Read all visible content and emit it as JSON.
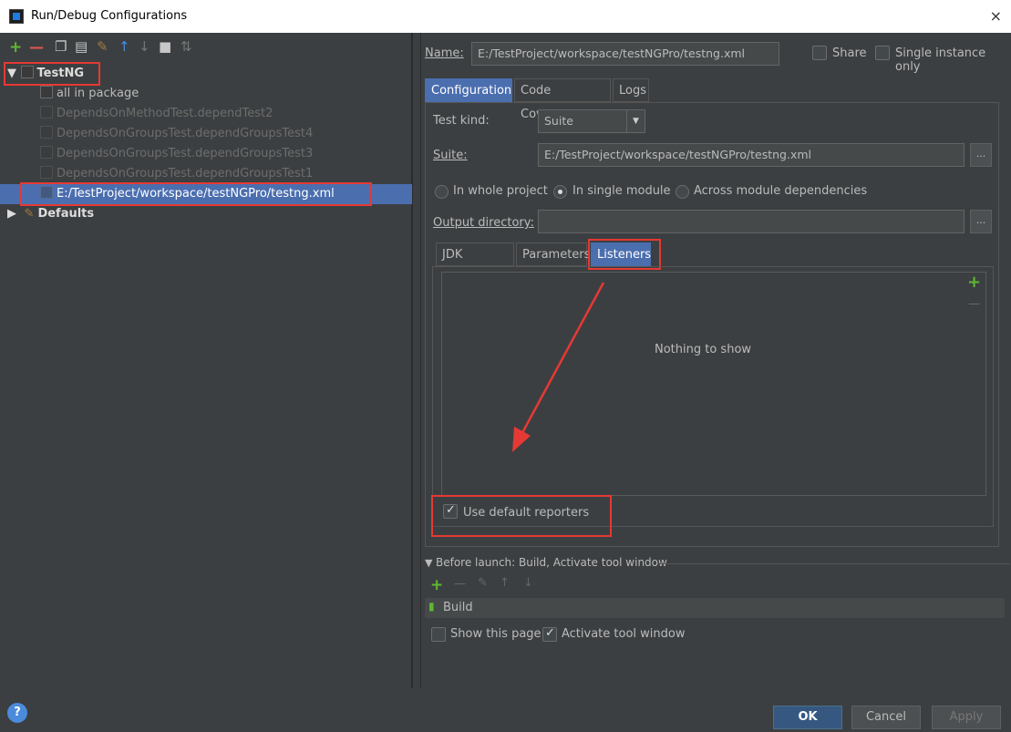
{
  "window": {
    "title": "Run/Debug Configurations",
    "close": "×"
  },
  "toolbar": {
    "add": "+",
    "remove": "—"
  },
  "tree": {
    "testng_label": "TestNG",
    "items": [
      "all in package",
      "DependsOnMethodTest.dependTest2",
      "DependsOnGroupsTest.dependGroupsTest4",
      "DependsOnGroupsTest.dependGroupsTest3",
      "DependsOnGroupsTest.dependGroupsTest1",
      "E:/TestProject/workspace/testNGPro/testng.xml"
    ],
    "defaults_label": "Defaults"
  },
  "name_row": {
    "label": "Name:",
    "value": "E:/TestProject/workspace/testNGPro/testng.xml",
    "share": "Share",
    "single_instance": "Single instance only"
  },
  "config_tabs": [
    "Configuration",
    "Code Coverage",
    "Logs"
  ],
  "config": {
    "test_kind_label": "Test kind:",
    "test_kind_value": "Suite",
    "suite_label": "Suite:",
    "suite_value": "E:/TestProject/workspace/testNGPro/testng.xml",
    "scope": [
      "In whole project",
      "In single module",
      "Across module dependencies"
    ],
    "output_label": "Output directory:",
    "output_value": "",
    "browse": "..."
  },
  "sub_tabs": [
    "JDK Settings",
    "Parameters",
    "Listeners"
  ],
  "listeners": {
    "empty": "Nothing to show",
    "add": "+",
    "remove": "—",
    "use_default": "Use default reporters"
  },
  "before_launch": {
    "title": "Before launch: Build, Activate tool window",
    "task": "Build",
    "show_page": "Show this page",
    "activate": "Activate tool window"
  },
  "buttons": {
    "ok": "OK",
    "cancel": "Cancel",
    "apply": "Apply",
    "help": "?"
  },
  "colors": {
    "background": "#3c3f41",
    "selection": "#4b6eaf",
    "highlight": "#e53935",
    "add_green": "#5fb832"
  }
}
